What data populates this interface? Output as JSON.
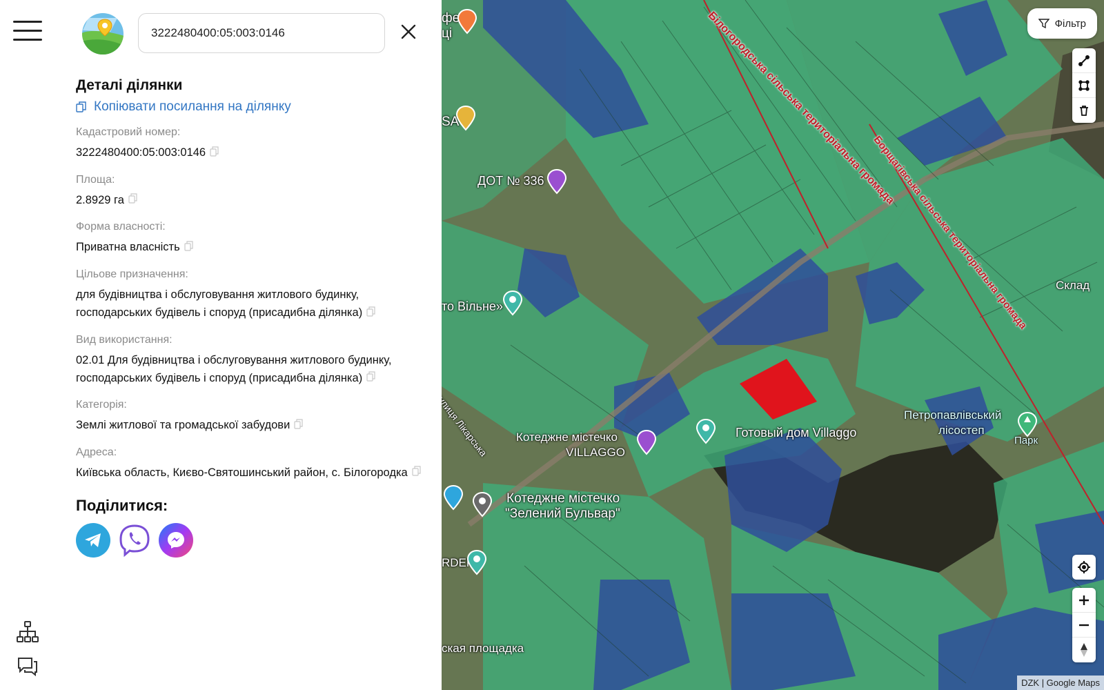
{
  "search": {
    "value": "3222480400:05:003:0146"
  },
  "details": {
    "title": "Деталі ділянки",
    "copy_link": "Копіювати посилання на ділянку",
    "fields": [
      {
        "label": "Кадастровий номер:",
        "value": "3222480400:05:003:0146"
      },
      {
        "label": "Площа:",
        "value": "2.8929 га"
      },
      {
        "label": "Форма власності:",
        "value": "Приватна власність"
      },
      {
        "label": "Цільове призначення:",
        "value": "для будівництва і обслуговування житлового будинку, господарських будівель і споруд (присадибна ділянка)"
      },
      {
        "label": "Вид використання:",
        "value": "02.01 Для будівництва і обслуговування житлового будинку, господарських будівель і споруд (присадибна ділянка)"
      },
      {
        "label": "Категорія:",
        "value": "Землі житлової та громадської забудови"
      },
      {
        "label": "Адреса:",
        "value": "Київська область, Києво-Святошинський район, с. Білогородка"
      }
    ],
    "share_title": "Поділитися:"
  },
  "map": {
    "filter_label": "Фільтр",
    "attribution": "DZK | Google Maps",
    "labels": {
      "dot": "ДОТ № 336",
      "vilne": "то Вільне»",
      "villaggo_town_1": "Котеджне містечко",
      "villaggo_town_2": "VILLAGGO",
      "villaggo_house": "Готовый дом Villaggo",
      "green_blvd_1": "Котеджне містечко",
      "green_blvd_2": "\"Зелений Бульвар\"",
      "petro_1": "Петропавлівський",
      "petro_2": "лісостеп",
      "park": "Парк",
      "sklad": "Склад",
      "likarska": "вулиця Лікарська",
      "ploshchadka": "ская площадка",
      "orden": "RDEN",
      "sa": "SA",
      "fe": "фе",
      "tsi": "ці"
    },
    "boundaries": {
      "bilohorodska": "Білогородська сільська територіальна громада",
      "bortsahivska": "Борщагівська сільська територіальна громада"
    },
    "colors": {
      "green_zone": "#3fae7a",
      "blue_zone": "#2f4f9a",
      "selected": "#e0141c",
      "boundary": "#c0202a"
    }
  }
}
